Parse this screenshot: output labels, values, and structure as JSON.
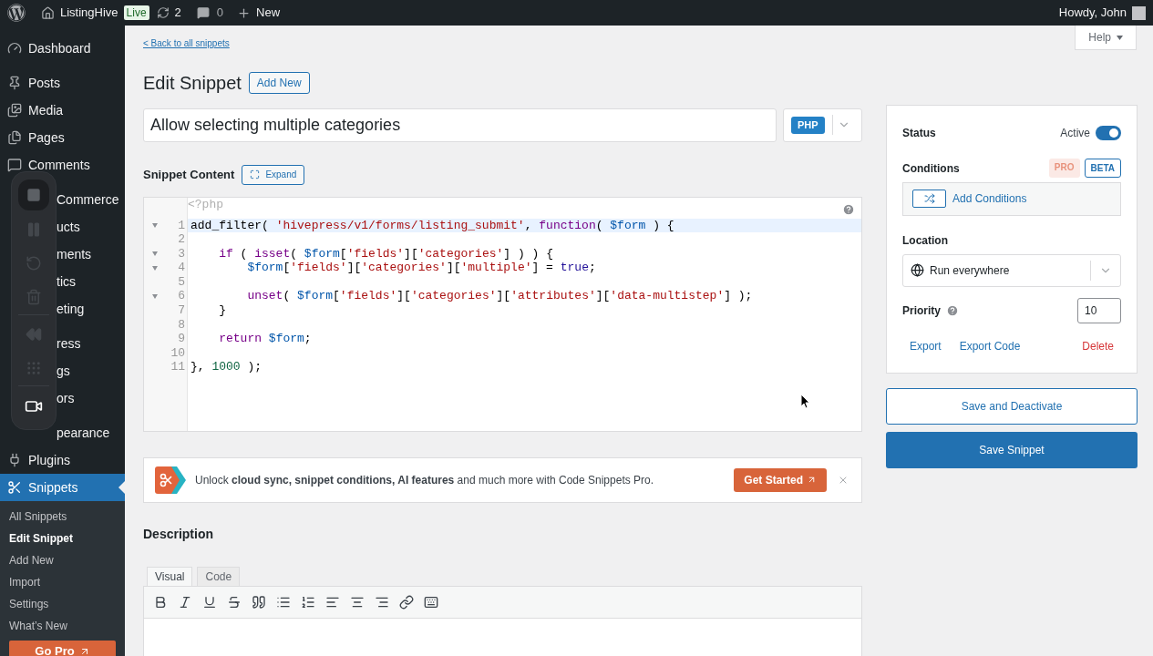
{
  "admin_bar": {
    "site_name": "ListingHive",
    "live_badge": "Live",
    "updates": "2",
    "comments": "0",
    "new_label": "New",
    "greeting": "Howdy, John"
  },
  "sidebar": {
    "menu_groups": [
      [
        {
          "label": "Dashboard",
          "kind": "dashboard",
          "covered": false,
          "selected": false
        }
      ],
      [
        {
          "label": "Posts",
          "kind": "posts",
          "covered": false,
          "selected": false
        },
        {
          "label": "Media",
          "kind": "media",
          "covered": false,
          "selected": false
        },
        {
          "label": "Pages",
          "kind": "pages",
          "covered": false,
          "selected": false
        },
        {
          "label": "Comments",
          "kind": "comments",
          "covered": false,
          "selected": false
        }
      ],
      [
        {
          "label": "Commerce",
          "covered": true,
          "selected": false
        },
        {
          "label": "ucts",
          "covered": true,
          "selected": false
        },
        {
          "label": "ments",
          "covered": true,
          "selected": false
        },
        {
          "label": "tics",
          "covered": true,
          "selected": false
        },
        {
          "label": "eting",
          "covered": true,
          "selected": false
        }
      ],
      [
        {
          "label": "ress",
          "covered": true,
          "selected": false
        },
        {
          "label": "gs",
          "covered": true,
          "selected": false
        },
        {
          "label": "ors",
          "covered": true,
          "selected": false
        }
      ],
      [
        {
          "label": "pearance",
          "covered": true,
          "selected": false
        },
        {
          "label": "Plugins",
          "kind": "plugins",
          "covered": false,
          "selected": false
        },
        {
          "label": "Snippets",
          "kind": "snippets",
          "covered": false,
          "selected": true
        }
      ]
    ],
    "submenu": [
      {
        "label": "All Snippets",
        "selected": false
      },
      {
        "label": "Edit Snippet",
        "selected": true
      },
      {
        "label": "Add New",
        "selected": false
      },
      {
        "label": "Import",
        "selected": false
      },
      {
        "label": "Settings",
        "selected": false
      },
      {
        "label": "What’s New",
        "selected": false
      }
    ],
    "go_pro": "Go Pro"
  },
  "page": {
    "back_link": "< Back to all snippets",
    "help_tab": "Help",
    "heading": "Edit Snippet",
    "add_new": "Add New",
    "title_field": {
      "value": "Allow selecting multiple categories"
    },
    "language_badge": "PHP",
    "content_label": "Snippet Content",
    "expand_button": "Expand",
    "editor": {
      "header": "<?php",
      "lines": [
        {
          "number": "1",
          "fold": true,
          "active": true,
          "tokens": [
            {
              "kind": "plain",
              "text": "add_filter( "
            },
            {
              "kind": "string",
              "text": "'hivepress/v1/forms/listing_submit'"
            },
            {
              "kind": "plain",
              "text": ", "
            },
            {
              "kind": "keyword",
              "text": "function"
            },
            {
              "kind": "plain",
              "text": "( "
            },
            {
              "kind": "variable",
              "text": "$form"
            },
            {
              "kind": "plain",
              "text": " ) {"
            }
          ]
        },
        {
          "number": "2",
          "fold": false,
          "active": false
        },
        {
          "number": "3",
          "fold": true,
          "active": false,
          "tokens": [
            {
              "kind": "keyword",
              "text": "    if"
            },
            {
              "kind": "plain",
              "text": " ( "
            },
            {
              "kind": "keyword",
              "text": "isset"
            },
            {
              "kind": "plain",
              "text": "( "
            },
            {
              "kind": "variable",
              "text": "$form"
            },
            {
              "kind": "plain",
              "text": "["
            },
            {
              "kind": "string",
              "text": "'fields'"
            },
            {
              "kind": "plain",
              "text": "]["
            },
            {
              "kind": "string",
              "text": "'categories'"
            },
            {
              "kind": "plain",
              "text": "] ) ) {"
            }
          ]
        },
        {
          "number": "4",
          "fold": true,
          "active": false,
          "tokens": [
            {
              "kind": "variable",
              "text": "        $form"
            },
            {
              "kind": "plain",
              "text": "["
            },
            {
              "kind": "string",
              "text": "'fields'"
            },
            {
              "kind": "plain",
              "text": "]["
            },
            {
              "kind": "string",
              "text": "'categories'"
            },
            {
              "kind": "plain",
              "text": "]["
            },
            {
              "kind": "string",
              "text": "'multiple'"
            },
            {
              "kind": "plain",
              "text": "] = "
            },
            {
              "kind": "atom",
              "text": "true"
            },
            {
              "kind": "plain",
              "text": ";"
            }
          ]
        },
        {
          "number": "5",
          "fold": false,
          "active": false
        },
        {
          "number": "6",
          "fold": true,
          "active": false,
          "tokens": [
            {
              "kind": "keyword",
              "text": "        unset"
            },
            {
              "kind": "plain",
              "text": "( "
            },
            {
              "kind": "variable",
              "text": "$form"
            },
            {
              "kind": "plain",
              "text": "["
            },
            {
              "kind": "string",
              "text": "'fields'"
            },
            {
              "kind": "plain",
              "text": "]["
            },
            {
              "kind": "string",
              "text": "'categories'"
            },
            {
              "kind": "plain",
              "text": "]["
            },
            {
              "kind": "string",
              "text": "'attributes'"
            },
            {
              "kind": "plain",
              "text": "]["
            },
            {
              "kind": "string",
              "text": "'data-multistep'"
            },
            {
              "kind": "plain",
              "text": "] );"
            }
          ]
        },
        {
          "number": "7",
          "fold": false,
          "active": false,
          "tokens": [
            {
              "kind": "plain",
              "text": "    }"
            }
          ]
        },
        {
          "number": "8",
          "fold": false,
          "active": false
        },
        {
          "number": "9",
          "fold": false,
          "active": false,
          "tokens": [
            {
              "kind": "keyword",
              "text": "    return "
            },
            {
              "kind": "variable",
              "text": "$form"
            },
            {
              "kind": "plain",
              "text": ";"
            }
          ]
        },
        {
          "number": "10",
          "fold": false,
          "active": false
        },
        {
          "number": "11",
          "fold": false,
          "active": false,
          "tokens": [
            {
              "kind": "plain",
              "text": "}, "
            },
            {
              "kind": "number",
              "text": "1000"
            },
            {
              "kind": "plain",
              "text": " );"
            }
          ]
        }
      ]
    },
    "promo": {
      "text": "Unlock **cloud sync, snippet conditions, AI features** and much more with Code Snippets Pro.",
      "button": "Get Started"
    },
    "description": {
      "label": "Description",
      "tabs": [
        {
          "label": "Visual",
          "selected": true
        },
        {
          "label": "Code",
          "selected": false
        }
      ]
    }
  },
  "settings_panel": {
    "status_label": "Status",
    "status_value": "Active",
    "active": true,
    "conditions_label": "Conditions",
    "badges": [
      {
        "label": "PRO",
        "kind": "pro"
      },
      {
        "label": "BETA",
        "kind": "beta"
      }
    ],
    "add_conditions": "Add Conditions",
    "location_label": "Location",
    "location_value": "Run everywhere",
    "priority_label": "Priority",
    "priority_value": "10",
    "links": [
      {
        "label": "Export",
        "kind": "link"
      },
      {
        "label": "Export Code",
        "kind": "link"
      },
      {
        "label": "Delete",
        "kind": "danger"
      }
    ]
  },
  "actions": [
    {
      "label": "Save and Deactivate",
      "kind": "secondary"
    },
    {
      "label": "Save Snippet",
      "kind": "primary"
    }
  ]
}
